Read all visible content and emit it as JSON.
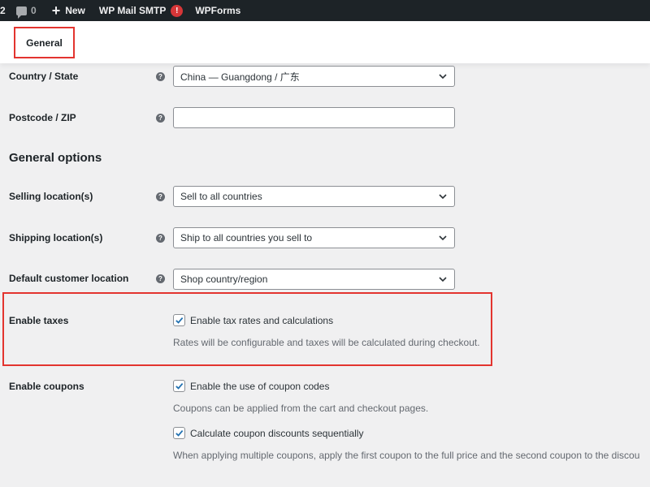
{
  "adminbar": {
    "updates_count": "2",
    "comments_count": "0",
    "new_label": "New",
    "smtp_label": "WP Mail SMTP",
    "smtp_badge": "!",
    "wpforms_label": "WPForms"
  },
  "tabs": {
    "general": "General"
  },
  "fields": {
    "country": {
      "label": "Country / State",
      "value": "China — Guangdong / 广东"
    },
    "postcode": {
      "label": "Postcode / ZIP",
      "value": ""
    },
    "section_title": "General options",
    "selling": {
      "label": "Selling location(s)",
      "value": "Sell to all countries"
    },
    "shipping": {
      "label": "Shipping location(s)",
      "value": "Ship to all countries you sell to"
    },
    "customer_location": {
      "label": "Default customer location",
      "value": "Shop country/region"
    },
    "taxes": {
      "label": "Enable taxes",
      "checkbox_label": "Enable tax rates and calculations",
      "description": "Rates will be configurable and taxes will be calculated during checkout."
    },
    "coupons": {
      "label": "Enable coupons",
      "checkbox1_label": "Enable the use of coupon codes",
      "description1": "Coupons can be applied from the cart and checkout pages.",
      "checkbox2_label": "Calculate coupon discounts sequentially",
      "description2": "When applying multiple coupons, apply the first coupon to the full price and the second coupon to the discou"
    }
  },
  "icons": {
    "help": "?",
    "help_icon": "question-circle-icon",
    "chevron_icon": "chevron-down-icon",
    "check_icon": "checkmark-icon"
  },
  "colors": {
    "adminbar_bg": "#1d2327",
    "highlight_red": "#e3342f",
    "checkbox_blue": "#2271b1",
    "badge_red": "#d63638"
  }
}
